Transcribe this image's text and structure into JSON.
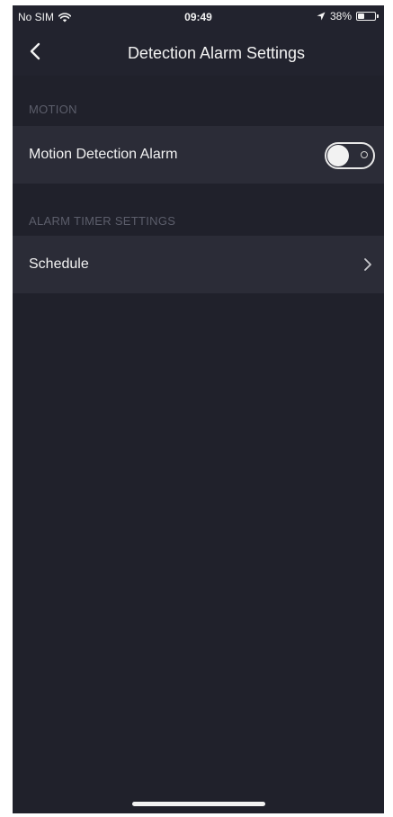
{
  "status_bar": {
    "carrier": "No SIM",
    "time": "09:49",
    "battery_percent_text": "38%",
    "battery_level": 0.38,
    "icons": [
      "wifi-icon",
      "location-arrow-icon",
      "battery-icon"
    ]
  },
  "nav": {
    "title": "Detection Alarm Settings",
    "back_icon": "chevron-left-icon"
  },
  "sections": [
    {
      "header": "MOTION",
      "rows": [
        {
          "label": "Motion Detection Alarm",
          "control": "toggle",
          "enabled": false
        }
      ]
    },
    {
      "header": "ALARM TIMER SETTINGS",
      "rows": [
        {
          "label": "Schedule",
          "control": "chevron-right-icon"
        }
      ]
    }
  ],
  "colors": {
    "background": "#20212b",
    "row_background": "#2b2c37",
    "text_primary": "#f2f2f2",
    "text_section": "#5c5e6b"
  }
}
